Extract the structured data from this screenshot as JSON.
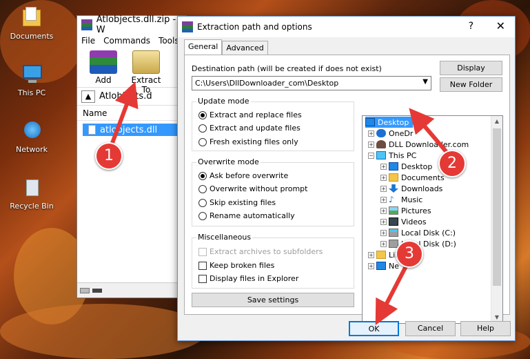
{
  "desktop": {
    "icons": [
      {
        "label": "Documents"
      },
      {
        "label": "This PC"
      },
      {
        "label": "Network"
      },
      {
        "label": "Recycle Bin"
      }
    ]
  },
  "winrar": {
    "title": "Atlobjects.dll.zip - W",
    "menu": [
      "File",
      "Commands",
      "Tools"
    ],
    "toolbar": {
      "add": "Add",
      "extract": "Extract To"
    },
    "path": "Atlobjects.d",
    "column_name": "Name",
    "file": "atlobjects.dll"
  },
  "dialog": {
    "title": "Extraction path and options",
    "help_glyph": "?",
    "tabs": [
      "General",
      "Advanced"
    ],
    "destination_label": "Destination path (will be created if does not exist)",
    "destination_value": "C:\\Users\\DllDownloader_com\\Desktop",
    "display_button": "Display",
    "new_folder_button": "New Folder",
    "update_mode": {
      "title": "Update mode",
      "options": [
        "Extract and replace files",
        "Extract and update files",
        "Fresh existing files only"
      ],
      "selected": 0
    },
    "overwrite_mode": {
      "title": "Overwrite mode",
      "options": [
        "Ask before overwrite",
        "Overwrite without prompt",
        "Skip existing files",
        "Rename automatically"
      ],
      "selected": 0
    },
    "misc": {
      "title": "Miscellaneous",
      "options": [
        "Extract archives to subfolders",
        "Keep broken files",
        "Display files in Explorer"
      ]
    },
    "save_settings": "Save settings",
    "tree": [
      {
        "label": "Desktop",
        "level": 0
      },
      {
        "label": "OneDr",
        "level": 1
      },
      {
        "label": "DLL Downloader.com",
        "level": 1
      },
      {
        "label": "This PC",
        "level": 1
      },
      {
        "label": "Desktop",
        "level": 2
      },
      {
        "label": "Documents",
        "level": 2
      },
      {
        "label": "Downloads",
        "level": 2
      },
      {
        "label": "Music",
        "level": 2
      },
      {
        "label": "Pictures",
        "level": 2
      },
      {
        "label": "Videos",
        "level": 2
      },
      {
        "label": "Local Disk (C:)",
        "level": 2
      },
      {
        "label": "Local Disk (D:)",
        "level": 2
      },
      {
        "label": "Libraries",
        "level": 1
      },
      {
        "label": "Ne",
        "level": 1
      }
    ],
    "ok": "OK",
    "cancel": "Cancel",
    "help": "Help"
  },
  "annotations": [
    "1",
    "2",
    "3"
  ],
  "colors": {
    "annotation": "#e53935",
    "selection": "#3399ff"
  }
}
